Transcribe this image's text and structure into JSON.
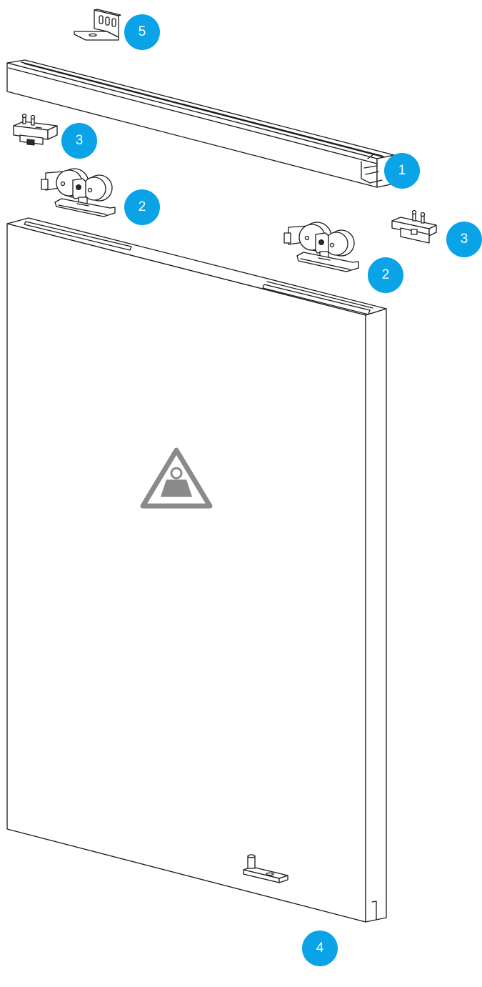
{
  "callouts": [
    {
      "key": "bracket_top",
      "label": "5"
    },
    {
      "key": "rail",
      "label": "1"
    },
    {
      "key": "stopper_left",
      "label": "3"
    },
    {
      "key": "carriage_left",
      "label": "2"
    },
    {
      "key": "stopper_right",
      "label": "3"
    },
    {
      "key": "carriage_right",
      "label": "2"
    },
    {
      "key": "floor_guide",
      "label": "4"
    }
  ],
  "colors": {
    "callout_fill": "#0aa3e8",
    "callout_text": "#ffffff",
    "line": "#1a1a1a",
    "weight_warning": "#8a8a8a"
  },
  "icons": {
    "weight_warning": "weight-warning-icon"
  }
}
